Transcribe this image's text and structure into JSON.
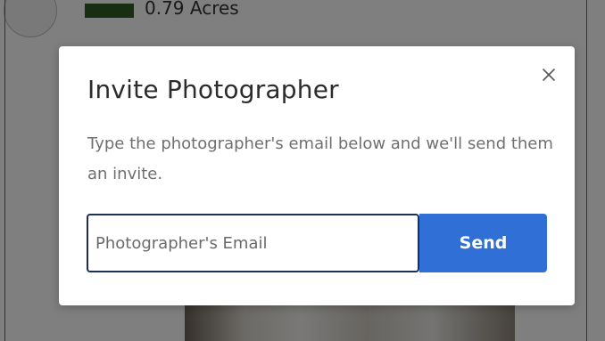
{
  "background": {
    "area_text": "0.79 Acres"
  },
  "modal": {
    "title": "Invite Photographer",
    "description": "Type the photographer's email below and we'll send them an invite.",
    "close_icon": "close-icon",
    "email_input": {
      "placeholder": "Photographer's Email",
      "value": ""
    },
    "send_label": "Send"
  },
  "colors": {
    "overlay": "rgba(0,0,0,0.5)",
    "send_button_bg": "#2f6fd6",
    "input_border": "#1c2f56",
    "title_text": "#2c2c2c",
    "description_text": "#6f6f6f"
  }
}
